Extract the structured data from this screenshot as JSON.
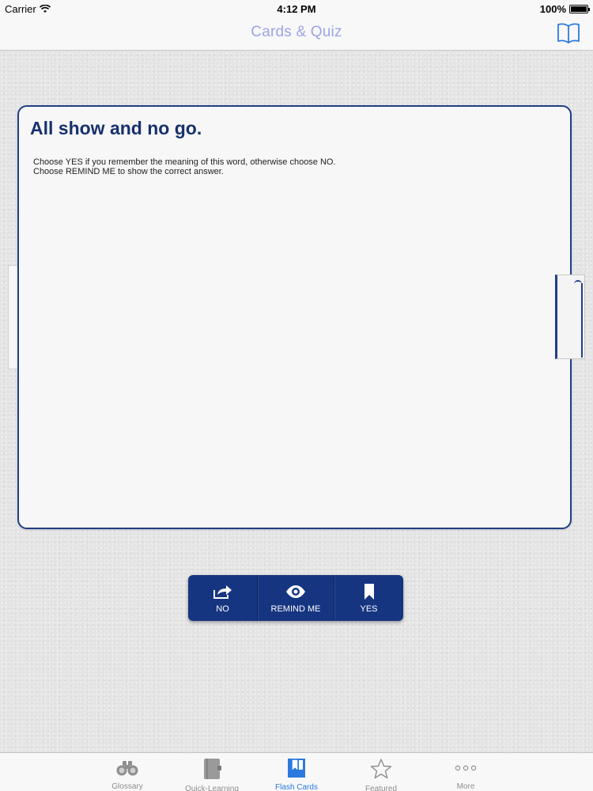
{
  "status_bar": {
    "carrier": "Carrier",
    "time": "4:12 PM",
    "battery": "100%"
  },
  "nav": {
    "title": "Cards & Quiz",
    "right_icon": "book-icon"
  },
  "card": {
    "title": "All show and no go.",
    "instruction_line1": "Choose YES if you remember the meaning of this word, otherwise choose NO.",
    "instruction_line2": "Choose REMIND ME to show the correct answer."
  },
  "actions": [
    {
      "label": "NO",
      "icon": "share-arrow-icon"
    },
    {
      "label": "REMIND ME",
      "icon": "eye-icon"
    },
    {
      "label": "YES",
      "icon": "bookmark-icon"
    }
  ],
  "tabs": [
    {
      "label": "Glossary",
      "icon": "binoculars-icon",
      "active": false
    },
    {
      "label": "Quick-Learning",
      "icon": "notebook-icon",
      "active": false
    },
    {
      "label": "Flash Cards",
      "icon": "flashcards-icon",
      "active": true
    },
    {
      "label": "Featured",
      "icon": "star-icon",
      "active": false
    },
    {
      "label": "More",
      "icon": "more-dots-icon",
      "active": false
    }
  ],
  "colors": {
    "accent": "#163581",
    "card_border": "#1f3f86",
    "title_text": "#17316e",
    "nav_title": "#9da4e8",
    "tab_active": "#2b7bde",
    "tab_inactive": "#8e8e8e"
  }
}
